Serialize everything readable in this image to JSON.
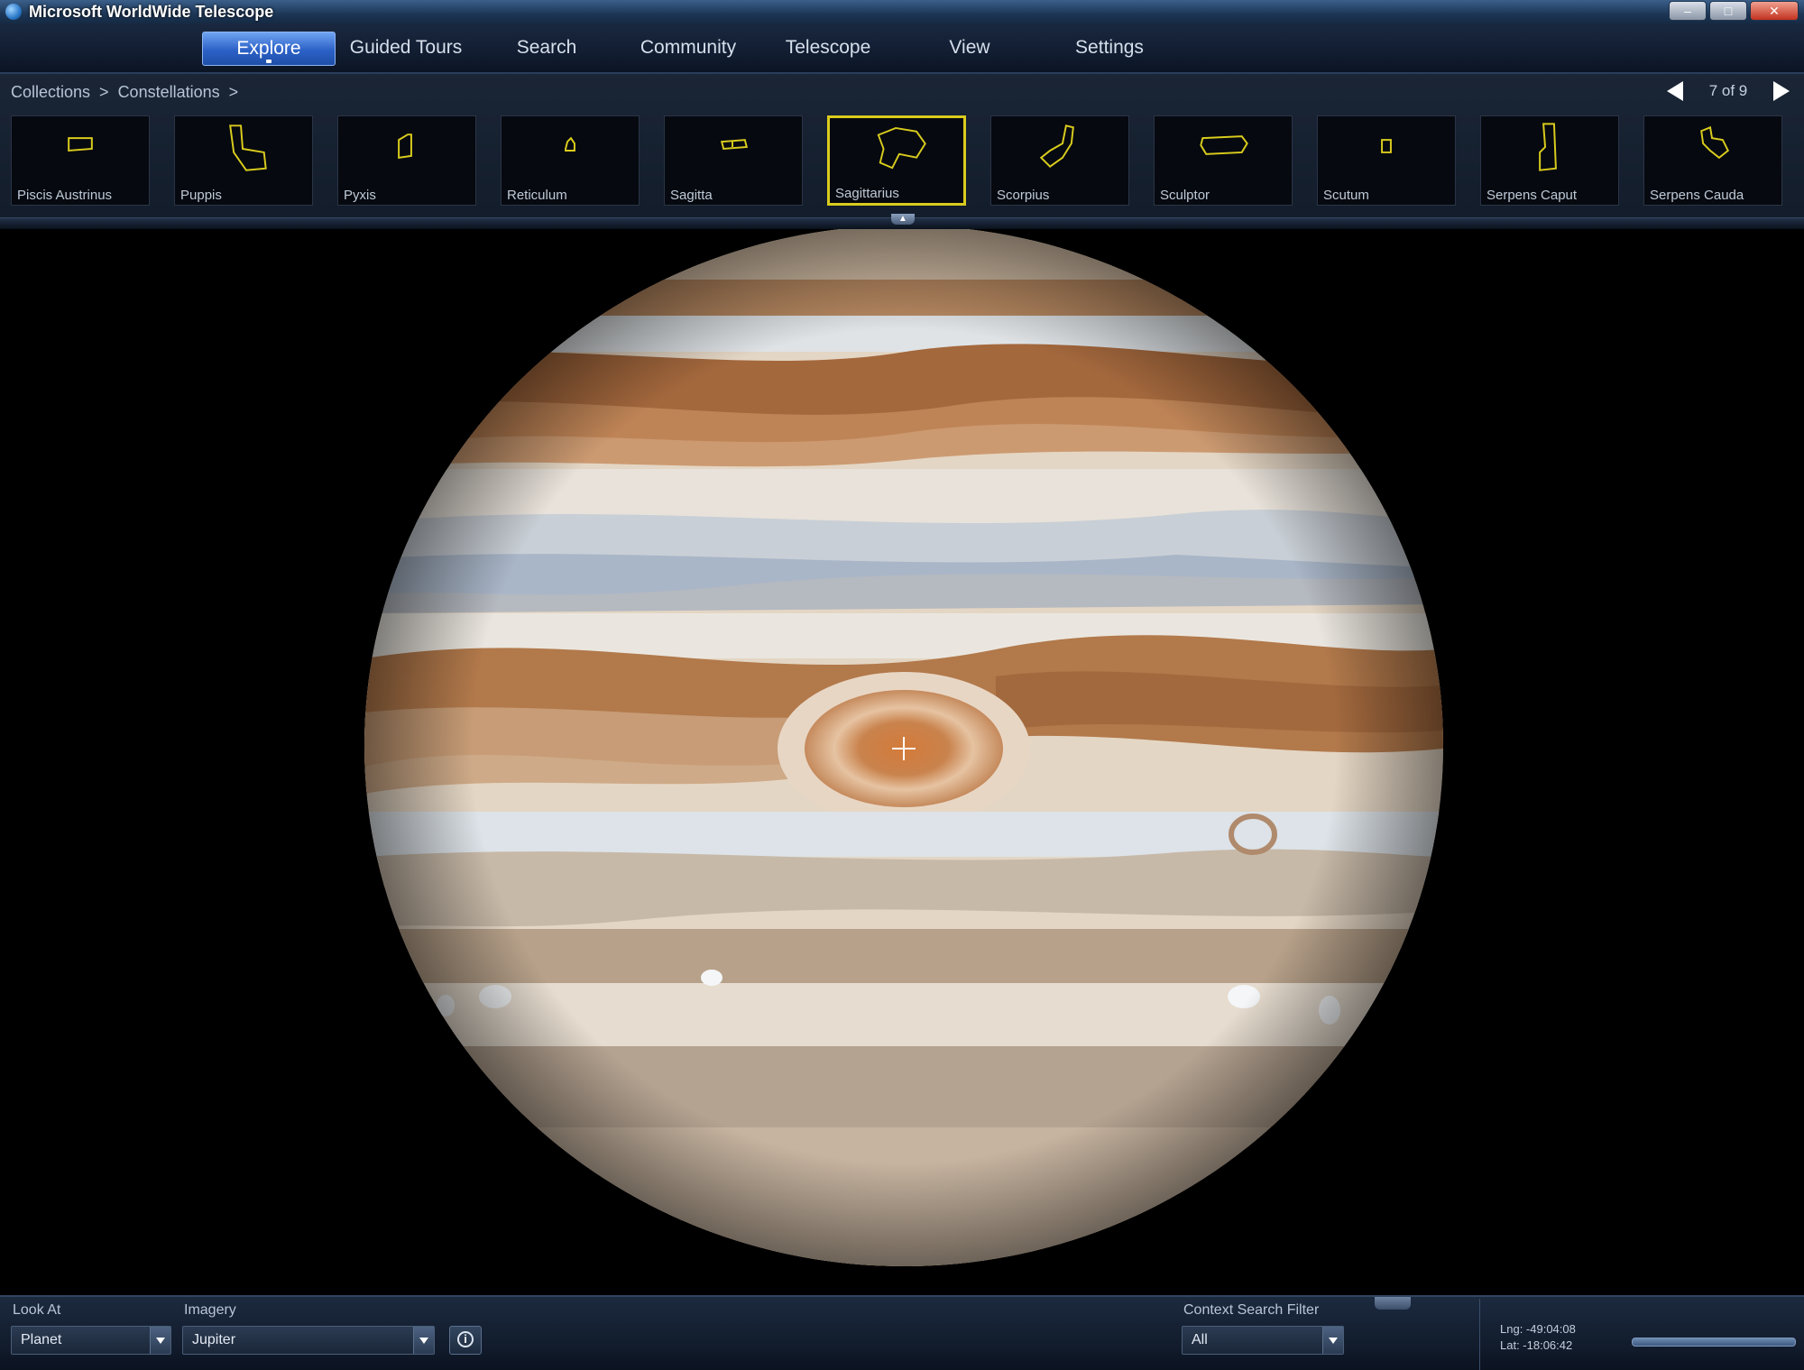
{
  "window": {
    "title": "Microsoft WorldWide Telescope"
  },
  "menu": {
    "items": [
      {
        "label": "Explore",
        "active": true
      },
      {
        "label": "Guided Tours"
      },
      {
        "label": "Search"
      },
      {
        "label": "Community"
      },
      {
        "label": "Telescope"
      },
      {
        "label": "View"
      },
      {
        "label": "Settings"
      }
    ]
  },
  "breadcrumb": {
    "items": [
      "Collections",
      ">",
      "Constellations",
      ">"
    ]
  },
  "pager": {
    "text": "7 of 9"
  },
  "collection": {
    "accent": "#d9cc1d",
    "items": [
      {
        "label": "Piscis Austrinus",
        "icon": "constellation-outline-icon"
      },
      {
        "label": "Puppis",
        "icon": "constellation-outline-icon"
      },
      {
        "label": "Pyxis",
        "icon": "constellation-outline-icon"
      },
      {
        "label": "Reticulum",
        "icon": "constellation-outline-icon"
      },
      {
        "label": "Sagitta",
        "icon": "constellation-outline-icon"
      },
      {
        "label": "Sagittarius",
        "icon": "constellation-outline-icon",
        "selected": true
      },
      {
        "label": "Scorpius",
        "icon": "constellation-outline-icon"
      },
      {
        "label": "Sculptor",
        "icon": "constellation-outline-icon"
      },
      {
        "label": "Scutum",
        "icon": "constellation-outline-icon"
      },
      {
        "label": "Serpens Caput",
        "icon": "constellation-outline-icon"
      },
      {
        "label": "Serpens Cauda",
        "icon": "constellation-outline-icon"
      }
    ]
  },
  "bottom": {
    "look_at": {
      "label": "Look At",
      "value": "Planet"
    },
    "imagery": {
      "label": "Imagery",
      "value": "Jupiter"
    },
    "context_filter": {
      "label": "Context Search Filter",
      "value": "All"
    },
    "coords": {
      "lng": "Lng:  -49:04:08",
      "lat": "Lat:  -18:06:42"
    }
  }
}
